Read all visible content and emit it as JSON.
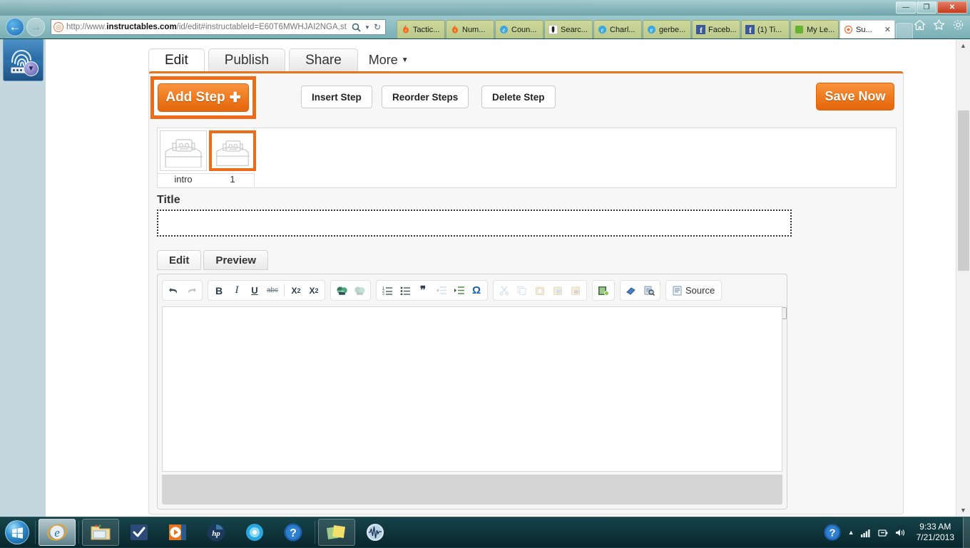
{
  "window": {
    "minimize_label": "—",
    "restore_label": "❐",
    "close_label": "✕"
  },
  "browser": {
    "back_label": "←",
    "forward_label": "→",
    "site_icon": "instructables-favicon",
    "url_prefix": "http://www.",
    "url_domain": "instructables.com",
    "url_suffix": "/id/edit#instructableId=E60T6MWHJAI2NGA,st",
    "search_icon": "search-icon",
    "dropdown_icon": "chevron-down-icon",
    "refresh_icon": "refresh-icon",
    "tools": [
      {
        "name": "home-icon",
        "glyph": "⌂"
      },
      {
        "name": "favorites-icon",
        "glyph": "★"
      },
      {
        "name": "settings-gear-icon",
        "glyph": "⚙"
      }
    ],
    "tabs": [
      {
        "label": "Tactic...",
        "favicon": "flame-icon",
        "glyph": "🔥",
        "active": false
      },
      {
        "label": "Num...",
        "favicon": "flame-icon",
        "glyph": "🔥",
        "active": false
      },
      {
        "label": "Coun...",
        "favicon": "ie-icon",
        "glyph": "e",
        "active": false
      },
      {
        "label": "Searc...",
        "favicon": "dark-site-icon",
        "glyph": "▯",
        "active": false
      },
      {
        "label": "Charl...",
        "favicon": "ie-icon",
        "glyph": "e",
        "active": false
      },
      {
        "label": "gerbe...",
        "favicon": "ie-icon",
        "glyph": "e",
        "active": false
      },
      {
        "label": "Faceb...",
        "favicon": "facebook-icon",
        "glyph": "f",
        "active": false
      },
      {
        "label": "(1) Ti...",
        "favicon": "facebook-icon",
        "glyph": "f",
        "active": false
      },
      {
        "label": "My Le...",
        "favicon": "green-square-icon",
        "glyph": "▰",
        "active": false
      },
      {
        "label": "Su...",
        "favicon": "instructables-favicon",
        "glyph": "◎",
        "active": true,
        "close_label": "✕"
      }
    ]
  },
  "sidebar": {
    "password_manager_icon": "fingerprint-password-icon"
  },
  "instructable": {
    "tabs": [
      {
        "label": "Edit",
        "active": true
      },
      {
        "label": "Publish",
        "active": false
      },
      {
        "label": "Share",
        "active": false
      }
    ],
    "more_label": "More",
    "more_caret": "▼",
    "actions": {
      "add_step": "Add Step",
      "add_step_plus": "✚",
      "insert_step": "Insert Step",
      "reorder_steps": "Reorder Steps",
      "delete_step": "Delete Step",
      "save_now": "Save Now"
    },
    "highlight_color": "#ef6b17",
    "accent_color": "#e8731c",
    "steps": [
      {
        "label": "intro",
        "selected": false,
        "thumb": "robot-placeholder-icon"
      },
      {
        "label": "1",
        "selected": true,
        "thumb": "robot-placeholder-icon"
      }
    ],
    "title_field": {
      "label": "Title",
      "value": "",
      "placeholder": ""
    },
    "editor_tabs": [
      {
        "label": "Edit",
        "active": true
      },
      {
        "label": "Preview",
        "active": false
      }
    ],
    "editor": {
      "body_value": "",
      "collapse_label": "▲",
      "toolbar_groups": [
        {
          "name": "history",
          "buttons": [
            {
              "name": "undo-icon",
              "glyph": "↶",
              "disabled": false
            },
            {
              "name": "redo-icon",
              "glyph": "↷",
              "disabled": true
            }
          ]
        },
        {
          "name": "text-format",
          "buttons": [
            {
              "name": "bold-icon",
              "glyph": "B",
              "disabled": false
            },
            {
              "name": "italic-icon",
              "glyph": "I",
              "disabled": false
            },
            {
              "name": "underline-icon",
              "glyph": "U",
              "disabled": false
            },
            {
              "name": "strikethrough-icon",
              "glyph": "abc",
              "disabled": false
            },
            {
              "name": "separator",
              "glyph": "|",
              "disabled": false
            },
            {
              "name": "subscript-icon",
              "glyph": "X₂",
              "disabled": false
            },
            {
              "name": "superscript-icon",
              "glyph": "X²",
              "disabled": false
            }
          ]
        },
        {
          "name": "links",
          "buttons": [
            {
              "name": "insert-link-icon",
              "glyph": "🌐",
              "disabled": false
            },
            {
              "name": "unlink-icon",
              "glyph": "🌐",
              "disabled": true
            }
          ]
        },
        {
          "name": "paragraph",
          "buttons": [
            {
              "name": "numbered-list-icon",
              "glyph": "1≡",
              "disabled": false
            },
            {
              "name": "bulleted-list-icon",
              "glyph": "•≡",
              "disabled": false
            },
            {
              "name": "blockquote-icon",
              "glyph": "❞",
              "disabled": false
            },
            {
              "name": "decrease-indent-icon",
              "glyph": "⇤",
              "disabled": true
            },
            {
              "name": "increase-indent-icon",
              "glyph": "⇥",
              "disabled": false
            },
            {
              "name": "special-character-icon",
              "glyph": "Ω",
              "disabled": false
            }
          ]
        },
        {
          "name": "clipboard",
          "buttons": [
            {
              "name": "cut-icon",
              "glyph": "✂",
              "disabled": true
            },
            {
              "name": "copy-icon",
              "glyph": "⧉",
              "disabled": true
            },
            {
              "name": "paste-icon",
              "glyph": "📋",
              "disabled": true
            },
            {
              "name": "paste-as-text-icon",
              "glyph": "📋",
              "disabled": true
            },
            {
              "name": "paste-from-word-icon",
              "glyph": "📋",
              "disabled": true
            }
          ]
        },
        {
          "name": "media",
          "buttons": [
            {
              "name": "insert-image-icon",
              "glyph": "🎞",
              "disabled": false
            }
          ]
        },
        {
          "name": "tools",
          "buttons": [
            {
              "name": "remove-format-icon",
              "glyph": "⬱",
              "disabled": false
            },
            {
              "name": "find-replace-icon",
              "glyph": "🔍",
              "disabled": false
            }
          ]
        },
        {
          "name": "source",
          "buttons": [
            {
              "name": "source-icon",
              "glyph": "▤",
              "label": "Source",
              "disabled": false
            }
          ]
        }
      ]
    }
  },
  "scrollbar": {
    "up_arrow": "▲",
    "down_arrow": "▼"
  },
  "taskbar": {
    "start_label": "start-orb",
    "items": [
      {
        "name": "internet-explorer",
        "glyph": "e",
        "state": "active"
      },
      {
        "name": "windows-explorer",
        "glyph": "🗂",
        "state": "grouped"
      },
      {
        "name": "outlook-tasks",
        "glyph": "✔",
        "state": "normal"
      },
      {
        "name": "media-player",
        "glyph": "▶",
        "state": "normal"
      },
      {
        "name": "hp-support",
        "glyph": "hp",
        "state": "normal"
      },
      {
        "name": "network-globe",
        "glyph": "◉",
        "state": "normal"
      },
      {
        "name": "help-center",
        "glyph": "?",
        "state": "normal"
      },
      {
        "name": "sticky-notes",
        "glyph": "▤",
        "state": "grouped"
      },
      {
        "name": "audio-editor",
        "glyph": "≋",
        "state": "normal"
      }
    ],
    "tray": {
      "help_icon": "question-mark-icon",
      "show_hidden_icon": "▲",
      "network_icon": "signal-bars-icon",
      "battery_icon": "battery-icon",
      "volume_icon": "speaker-icon",
      "time": "9:33 AM",
      "date": "7/21/2013"
    }
  }
}
